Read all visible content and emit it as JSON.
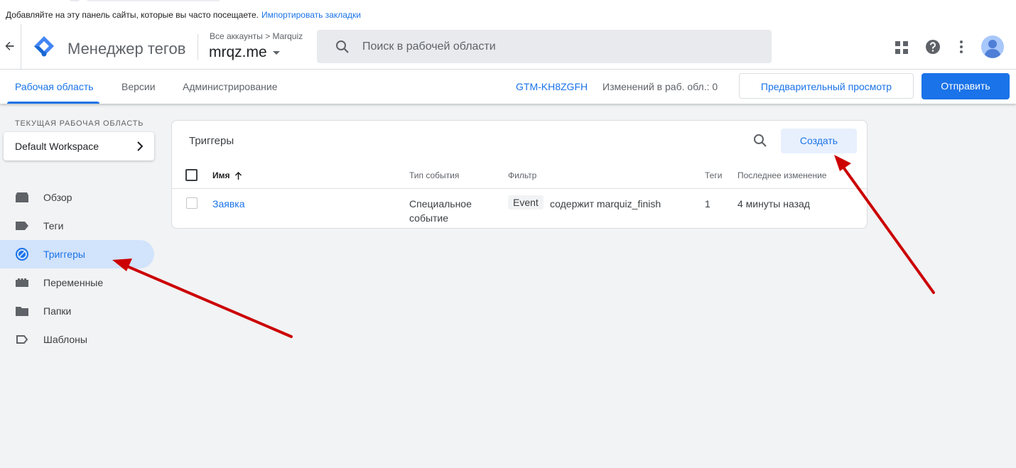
{
  "bookmarks_bar": {
    "text": "Добавляйте на эту панель сайты, которые вы часто посещаете.",
    "link": "Импортировать закладки"
  },
  "header": {
    "product_name": "Менеджер тегов",
    "breadcrumb": {
      "parent": "Все аккаунты",
      "separator": ">",
      "account": "Marquiz"
    },
    "container_name": "mrqz.me",
    "search_placeholder": "Поиск в рабочей области",
    "icons": [
      "back-arrow-icon",
      "gtm-logo-icon",
      "search-icon",
      "apps-icon",
      "help-icon",
      "more-vert-icon",
      "avatar-icon"
    ]
  },
  "tabs": [
    {
      "label": "Рабочая область",
      "active": true
    },
    {
      "label": "Версии",
      "active": false
    },
    {
      "label": "Администрирование",
      "active": false
    }
  ],
  "workspace_bar": {
    "container_id": "GTM-KH8ZGFH",
    "changes_label": "Изменений в раб. обл.: 0",
    "preview_button": "Предварительный просмотр",
    "submit_button": "Отправить"
  },
  "sidebar": {
    "workspace_label": "ТЕКУЩАЯ РАБОЧАЯ ОБЛАСТЬ",
    "workspace_name": "Default Workspace",
    "items": [
      {
        "label": "Обзор",
        "icon": "overview-icon",
        "active": false
      },
      {
        "label": "Теги",
        "icon": "tag-icon",
        "active": false
      },
      {
        "label": "Триггеры",
        "icon": "trigger-icon",
        "active": true
      },
      {
        "label": "Переменные",
        "icon": "variable-icon",
        "active": false
      },
      {
        "label": "Папки",
        "icon": "folder-icon",
        "active": false
      },
      {
        "label": "Шаблоны",
        "icon": "template-icon",
        "active": false
      }
    ]
  },
  "triggers": {
    "title": "Триггеры",
    "create_button": "Создать",
    "columns": [
      "Имя",
      "Тип события",
      "Фильтр",
      "Теги",
      "Последнее изменение"
    ],
    "rows": [
      {
        "name": "Заявка",
        "event_type": "Специальное событие",
        "filter_variable": "Event",
        "filter_condition": "содержит marquiz_finish",
        "tags": "1",
        "last_modified": "4 минуты назад"
      }
    ]
  },
  "colors": {
    "accent": "#1a73e8",
    "background": "#f1f3f4",
    "active_nav": "#d2e3fc",
    "annotation_arrow": "#cc0000"
  }
}
